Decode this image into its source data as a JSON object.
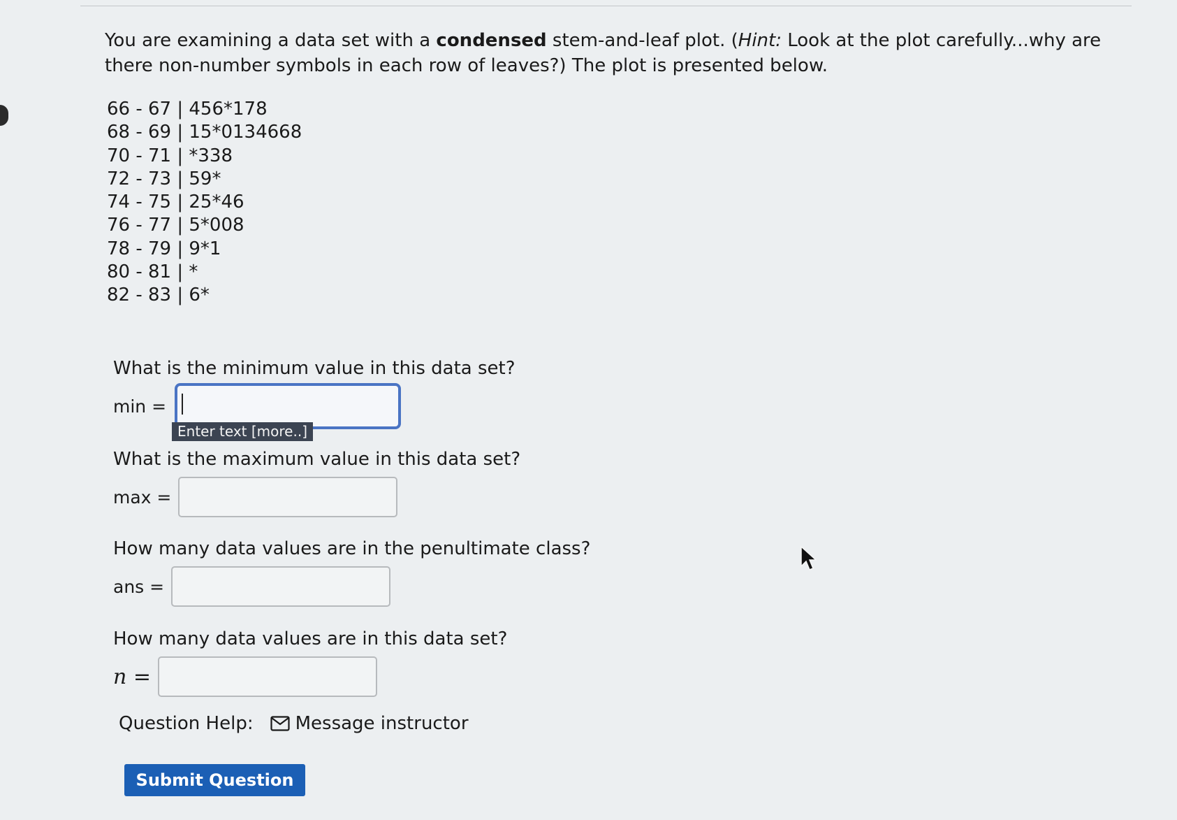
{
  "intro": {
    "part1": "You are examining a data set with a ",
    "bold": "condensed",
    "part2": " stem-and-leaf plot. (",
    "italic": "Hint:",
    "part3": " Look at the plot carefully...why are there non-number symbols in each row of leaves?) The plot is presented below."
  },
  "stem_leaf_rows": [
    "66 - 67 | 456*178",
    "68 - 69 | 15*0134668",
    "70 - 71 | *338",
    "72 - 73 | 59*",
    "74 - 75 | 25*46",
    "76 - 77 | 5*008",
    "78 - 79 | 9*1",
    "80 - 81 | *",
    "82 - 83 | 6*"
  ],
  "questions": {
    "min": {
      "text": "What is the minimum value in this data set?",
      "label": "min =",
      "value": ""
    },
    "max": {
      "text": "What is the maximum value in this data set?",
      "label": "max =",
      "value": ""
    },
    "ans": {
      "text": "How many data values are in the penultimate class?",
      "label": "ans =",
      "value": ""
    },
    "n": {
      "text": "How many data values are in this data set?",
      "label": "n =",
      "value": ""
    }
  },
  "tooltip": "Enter text [more..]",
  "help": {
    "label": "Question Help:",
    "icon": "mail-icon",
    "link": "Message instructor"
  },
  "submit_label": "Submit Question",
  "colors": {
    "background": "#eceff1",
    "focus_border": "#4a74c4",
    "submit_button": "#1b5fb5",
    "tooltip_bg": "#3c4452"
  }
}
